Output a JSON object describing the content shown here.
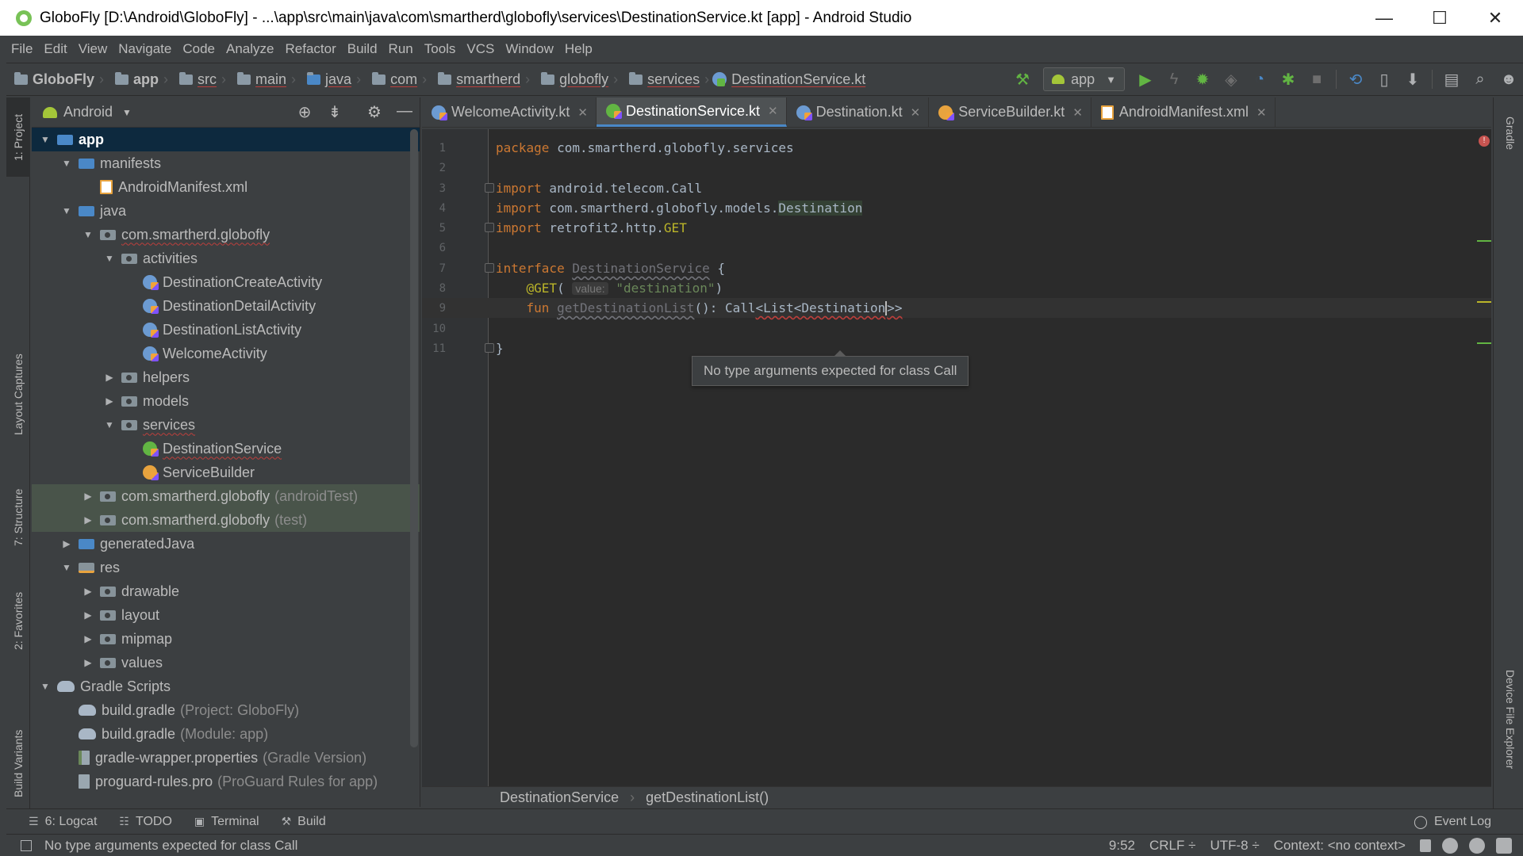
{
  "window": {
    "title": "GloboFly [D:\\Android\\GloboFly] - ...\\app\\src\\main\\java\\com\\smartherd\\globofly\\services\\DestinationService.kt [app] - Android Studio",
    "minimize": "—",
    "maximize": "☐",
    "close": "✕"
  },
  "menu": [
    "File",
    "Edit",
    "View",
    "Navigate",
    "Code",
    "Analyze",
    "Refactor",
    "Build",
    "Run",
    "Tools",
    "VCS",
    "Window",
    "Help"
  ],
  "breadcrumbs": [
    "GloboFly",
    "app",
    "src",
    "main",
    "java",
    "com",
    "smartherd",
    "globofly",
    "services",
    "DestinationService.kt"
  ],
  "toolbar": {
    "run_config": "app",
    "icons": [
      "hammer-icon",
      "run-icon",
      "apply-changes-icon",
      "debug-icon",
      "coverage-icon",
      "profile-icon",
      "attach-debugger-icon",
      "stop-icon",
      "sync-icon",
      "avd-manager-icon",
      "sdk-manager-icon",
      "project-structure-icon",
      "search-icon",
      "user-icon"
    ]
  },
  "left_strip": {
    "project": "1: Project",
    "layout_captures": "Layout Captures",
    "structure": "7: Structure",
    "favorites": "2: Favorites",
    "build_variants": "Build Variants"
  },
  "right_strip": {
    "gradle": "Gradle",
    "device_file_explorer": "Device File Explorer"
  },
  "project_panel": {
    "view_mode": "Android",
    "tree": [
      {
        "label": "app",
        "depth": 0,
        "arrow": "▼",
        "icon": "folder-blue",
        "selected": true
      },
      {
        "label": "manifests",
        "depth": 1,
        "arrow": "▼",
        "icon": "folder-blue"
      },
      {
        "label": "AndroidManifest.xml",
        "depth": 2,
        "arrow": "",
        "icon": "xml"
      },
      {
        "label": "java",
        "depth": 1,
        "arrow": "▼",
        "icon": "folder-blue"
      },
      {
        "label": "com.smartherd.globofly",
        "depth": 2,
        "arrow": "▼",
        "icon": "pkg",
        "error": true
      },
      {
        "label": "activities",
        "depth": 3,
        "arrow": "▼",
        "icon": "pkg"
      },
      {
        "label": "DestinationCreateActivity",
        "depth": 4,
        "arrow": "",
        "icon": "kt"
      },
      {
        "label": "DestinationDetailActivity",
        "depth": 4,
        "arrow": "",
        "icon": "kt"
      },
      {
        "label": "DestinationListActivity",
        "depth": 4,
        "arrow": "",
        "icon": "kt"
      },
      {
        "label": "WelcomeActivity",
        "depth": 4,
        "arrow": "",
        "icon": "kt"
      },
      {
        "label": "helpers",
        "depth": 3,
        "arrow": "▶",
        "icon": "pkg"
      },
      {
        "label": "models",
        "depth": 3,
        "arrow": "▶",
        "icon": "pkg"
      },
      {
        "label": "services",
        "depth": 3,
        "arrow": "▼",
        "icon": "pkg",
        "error": true
      },
      {
        "label": "DestinationService",
        "depth": 4,
        "arrow": "",
        "icon": "kt-green",
        "error": true
      },
      {
        "label": "ServiceBuilder",
        "depth": 4,
        "arrow": "",
        "icon": "kt-orange"
      },
      {
        "label": "com.smartherd.globofly",
        "suffix": "(androidTest)",
        "depth": 2,
        "arrow": "▶",
        "icon": "pkg",
        "test": true
      },
      {
        "label": "com.smartherd.globofly",
        "suffix": "(test)",
        "depth": 2,
        "arrow": "▶",
        "icon": "pkg",
        "test": true
      },
      {
        "label": "generatedJava",
        "depth": 1,
        "arrow": "▶",
        "icon": "folder-blue"
      },
      {
        "label": "res",
        "depth": 1,
        "arrow": "▼",
        "icon": "res"
      },
      {
        "label": "drawable",
        "depth": 2,
        "arrow": "▶",
        "icon": "pkg"
      },
      {
        "label": "layout",
        "depth": 2,
        "arrow": "▶",
        "icon": "pkg"
      },
      {
        "label": "mipmap",
        "depth": 2,
        "arrow": "▶",
        "icon": "pkg"
      },
      {
        "label": "values",
        "depth": 2,
        "arrow": "▶",
        "icon": "pkg"
      },
      {
        "label": "Gradle Scripts",
        "depth": 0,
        "arrow": "▼",
        "icon": "gradle"
      },
      {
        "label": "build.gradle",
        "suffix": "(Project: GloboFly)",
        "depth": 1,
        "arrow": "",
        "icon": "gradle"
      },
      {
        "label": "build.gradle",
        "suffix": "(Module: app)",
        "depth": 1,
        "arrow": "",
        "icon": "gradle"
      },
      {
        "label": "gradle-wrapper.properties",
        "suffix": "(Gradle Version)",
        "depth": 1,
        "arrow": "",
        "icon": "file-bar"
      },
      {
        "label": "proguard-rules.pro",
        "suffix": "(ProGuard Rules for app)",
        "depth": 1,
        "arrow": "",
        "icon": "file"
      }
    ]
  },
  "editor_tabs": [
    {
      "label": "WelcomeActivity.kt",
      "icon": "kt",
      "active": false
    },
    {
      "label": "DestinationService.kt",
      "icon": "kt-green",
      "active": true
    },
    {
      "label": "Destination.kt",
      "icon": "kt",
      "active": false
    },
    {
      "label": "ServiceBuilder.kt",
      "icon": "kt-orange",
      "active": false
    },
    {
      "label": "AndroidManifest.xml",
      "icon": "xml",
      "active": false
    }
  ],
  "code": {
    "line_numbers": [
      "1",
      "2",
      "3",
      "4",
      "5",
      "6",
      "7",
      "8",
      "9",
      "10",
      "11"
    ],
    "l1_kw": "package",
    "l1_rest": " com.smartherd.globofly.services",
    "l3_kw": "import",
    "l3_rest": " android.telecom.Call",
    "l4_kw": "import",
    "l4_rest": " com.smartherd.globofly.models.",
    "l4_hl": "Destination",
    "l5_kw": "import",
    "l5_rest": " retrofit2.http.",
    "l5_ann": "GET",
    "l7_kw": "interface",
    "l7_sp": " ",
    "l7_name": "DestinationService",
    "l7_rest": " {",
    "l8_indent": "    ",
    "l8_ann": "@GET",
    "l8_paren": "( ",
    "l8_hint": "value:",
    "l8_sp": " ",
    "l8_str": "\"destination\"",
    "l8_close": ")",
    "l9_indent": "    ",
    "l9_kw": "fun",
    "l9_sp": " ",
    "l9_name": "getDestinationList",
    "l9_mid": "(): Call",
    "l9_err": "<List<Destination",
    "l9_end": ">>",
    "l11": "}"
  },
  "tooltip": "No type arguments expected for class Call",
  "editor_breadcrumb": [
    "DestinationService",
    "getDestinationList()"
  ],
  "bottom_tabs": [
    {
      "label": "6: Logcat",
      "icon": "logcat-icon"
    },
    {
      "label": "TODO",
      "icon": "todo-icon"
    },
    {
      "label": "Terminal",
      "icon": "terminal-icon"
    },
    {
      "label": "Build",
      "icon": "build-icon"
    }
  ],
  "event_log": "Event Log",
  "status": {
    "message": "No type arguments expected for class Call",
    "position": "9:52",
    "line_sep": "CRLF ÷",
    "encoding": "UTF-8 ÷",
    "context": "Context: <no context>"
  }
}
